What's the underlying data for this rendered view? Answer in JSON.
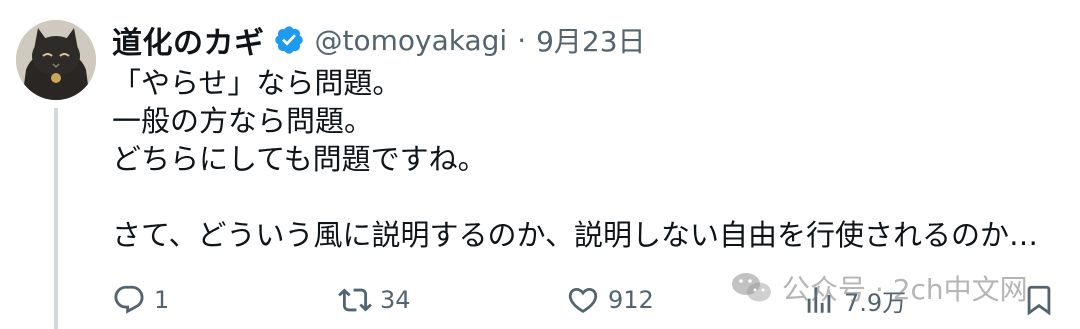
{
  "tweet": {
    "display_name": "道化のカギ",
    "handle": "@tomoyakagi",
    "separator": "·",
    "date": "9月23日",
    "lines": [
      "「やらせ」なら問題。",
      "一般の方なら問題。",
      "どちらにしても問題ですね。",
      "",
      "さて、どういう風に説明するのか、説明しない自由を行使されるのか…"
    ]
  },
  "actions": {
    "reply_count": "1",
    "retweet_count": "34",
    "like_count": "912",
    "views_count": "7.9万"
  },
  "watermark": {
    "text": "公众号 · 2ch中文网"
  },
  "colors": {
    "text_primary": "#0f1419",
    "text_secondary": "#536471",
    "verified_blue": "#1d9bf0",
    "thread_line": "#cfd9de"
  }
}
